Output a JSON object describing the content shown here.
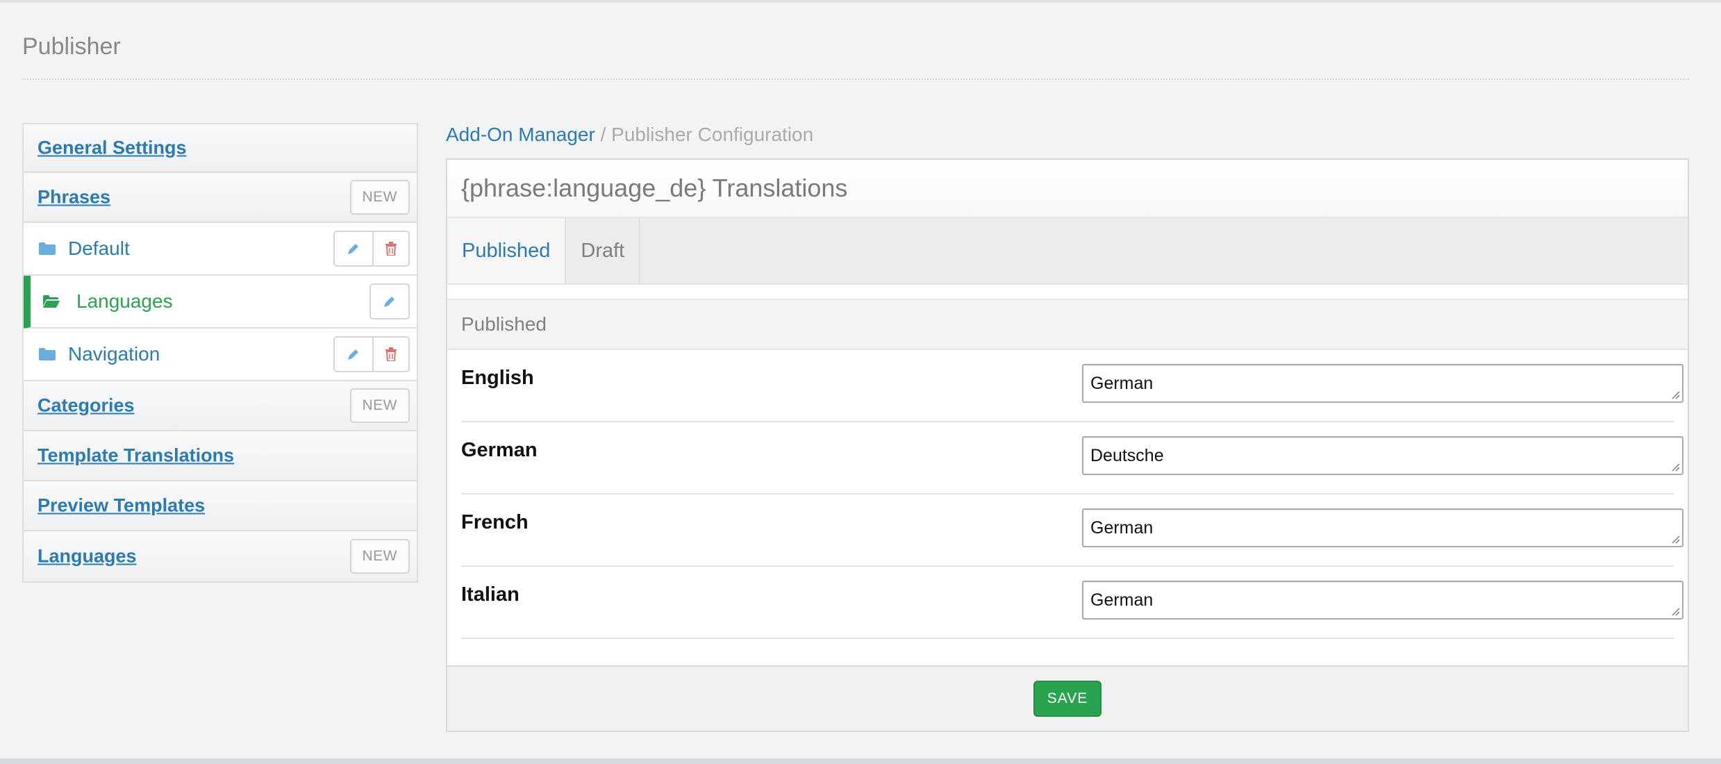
{
  "page": {
    "title": "Publisher"
  },
  "sidebar": {
    "general_settings": "General Settings",
    "phrases": {
      "label": "Phrases",
      "new_label": "NEW"
    },
    "phrase_groups": [
      {
        "label": "Default"
      },
      {
        "label": "Languages"
      },
      {
        "label": "Navigation"
      }
    ],
    "categories": {
      "label": "Categories",
      "new_label": "NEW"
    },
    "template_translations": "Template Translations",
    "preview_templates": "Preview Templates",
    "languages": {
      "label": "Languages",
      "new_label": "NEW"
    }
  },
  "breadcrumb": {
    "link": "Add-On Manager",
    "separator": "/",
    "current": "Publisher Configuration"
  },
  "panel": {
    "title": "{phrase:language_de} Translations",
    "tabs": [
      "Published",
      "Draft"
    ],
    "section_title": "Published",
    "rows": [
      {
        "label": "English",
        "value": "German"
      },
      {
        "label": "German",
        "value": "Deutsche"
      },
      {
        "label": "French",
        "value": "German"
      },
      {
        "label": "Italian",
        "value": "German"
      }
    ],
    "save_label": "SAVE"
  },
  "colors": {
    "link": "#2a7ab5",
    "active_green": "#2aa351",
    "delete_red": "#e07070",
    "edit_blue": "#6aaee0"
  },
  "icons": {
    "folder": "folder-icon",
    "folder_open": "folder-open-icon",
    "edit": "pencil-icon",
    "delete": "trash-icon"
  }
}
